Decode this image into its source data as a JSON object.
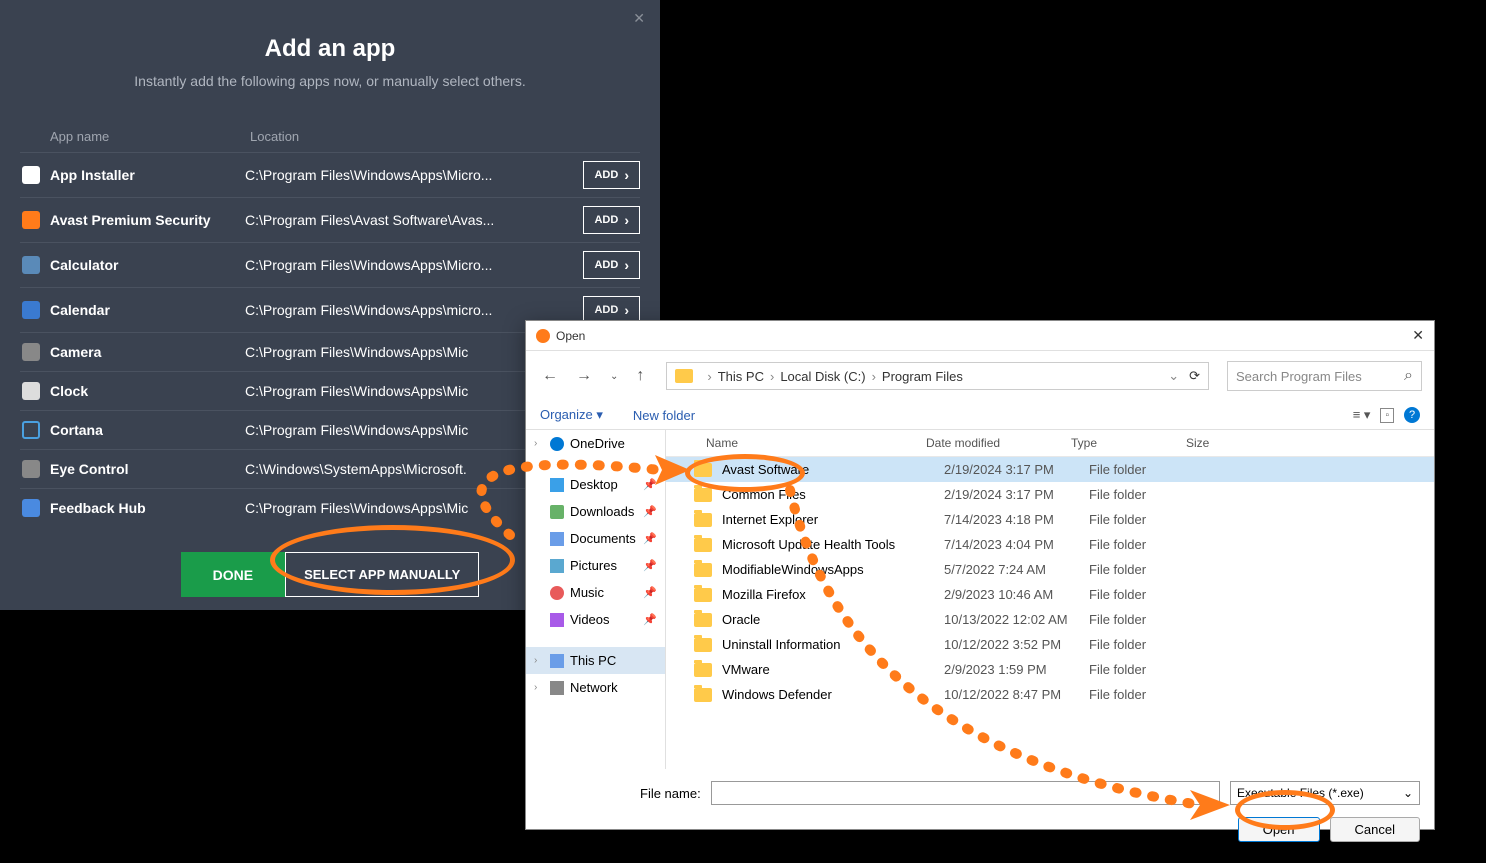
{
  "dark_panel": {
    "title": "Add an app",
    "subtitle": "Instantly add the following apps now, or manually select others.",
    "col_name": "App name",
    "col_loc": "Location",
    "add_label": "ADD",
    "done_label": "DONE",
    "select_manual_label": "SELECT APP MANUALLY",
    "apps": [
      {
        "name": "App Installer",
        "loc": "C:\\Program Files\\WindowsApps\\Micro...",
        "icon_bg": "#fff",
        "has_btn": true
      },
      {
        "name": "Avast Premium Security",
        "loc": "C:\\Program Files\\Avast Software\\Avas...",
        "icon_bg": "#ff7b1a",
        "has_btn": true
      },
      {
        "name": "Calculator",
        "loc": "C:\\Program Files\\WindowsApps\\Micro...",
        "icon_bg": "#5a8ab8",
        "has_btn": true
      },
      {
        "name": "Calendar",
        "loc": "C:\\Program Files\\WindowsApps\\micro...",
        "icon_bg": "#3a7ad0",
        "has_btn": true
      },
      {
        "name": "Camera",
        "loc": "C:\\Program Files\\WindowsApps\\Mic",
        "icon_bg": "#888",
        "has_btn": false
      },
      {
        "name": "Clock",
        "loc": "C:\\Program Files\\WindowsApps\\Mic",
        "icon_bg": "#ddd",
        "has_btn": false
      },
      {
        "name": "Cortana",
        "loc": "C:\\Program Files\\WindowsApps\\Mic",
        "icon_bg": "transparent",
        "has_btn": false
      },
      {
        "name": "Eye Control",
        "loc": "C:\\Windows\\SystemApps\\Microsoft.",
        "icon_bg": "#888",
        "has_btn": false
      },
      {
        "name": "Feedback Hub",
        "loc": "C:\\Program Files\\WindowsApps\\Mic",
        "icon_bg": "#4a8ae0",
        "has_btn": false
      }
    ]
  },
  "file_dialog": {
    "title": "Open",
    "breadcrumb": [
      "This PC",
      "Local Disk (C:)",
      "Program Files"
    ],
    "search_placeholder": "Search Program Files",
    "organize": "Organize",
    "newfolder": "New folder",
    "cols": {
      "name": "Name",
      "date": "Date modified",
      "type": "Type",
      "size": "Size"
    },
    "sidebar": [
      {
        "label": "OneDrive",
        "icon": "cloud",
        "expand": true
      },
      {
        "label": "Desktop",
        "icon": "desktop",
        "pin": true
      },
      {
        "label": "Downloads",
        "icon": "download",
        "pin": true
      },
      {
        "label": "Documents",
        "icon": "docs",
        "pin": true
      },
      {
        "label": "Pictures",
        "icon": "pics",
        "pin": true
      },
      {
        "label": "Music",
        "icon": "music",
        "pin": true
      },
      {
        "label": "Videos",
        "icon": "videos",
        "pin": true
      },
      {
        "label": "This PC",
        "icon": "pc",
        "expand": true,
        "selected": true
      },
      {
        "label": "Network",
        "icon": "network",
        "expand": true
      }
    ],
    "files": [
      {
        "name": "Avast Software",
        "date": "2/19/2024 3:17 PM",
        "type": "File folder",
        "selected": true
      },
      {
        "name": "Common Files",
        "date": "2/19/2024 3:17 PM",
        "type": "File folder"
      },
      {
        "name": "Internet Explorer",
        "date": "7/14/2023 4:18 PM",
        "type": "File folder"
      },
      {
        "name": "Microsoft Update Health Tools",
        "date": "7/14/2023 4:04 PM",
        "type": "File folder"
      },
      {
        "name": "ModifiableWindowsApps",
        "date": "5/7/2022 7:24 AM",
        "type": "File folder"
      },
      {
        "name": "Mozilla Firefox",
        "date": "2/9/2023 10:46 AM",
        "type": "File folder"
      },
      {
        "name": "Oracle",
        "date": "10/13/2022 12:02 AM",
        "type": "File folder"
      },
      {
        "name": "Uninstall Information",
        "date": "10/12/2022 3:52 PM",
        "type": "File folder"
      },
      {
        "name": "VMware",
        "date": "2/9/2023 1:59 PM",
        "type": "File folder"
      },
      {
        "name": "Windows Defender",
        "date": "10/12/2022 8:47 PM",
        "type": "File folder"
      }
    ],
    "filename_label": "File name:",
    "filter": "Executable Files (*.exe)",
    "open_label": "Open",
    "cancel_label": "Cancel"
  }
}
